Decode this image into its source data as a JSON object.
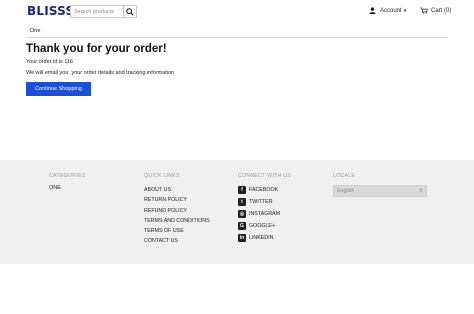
{
  "header": {
    "logo": "BLISSS",
    "logo_dot": ".",
    "search_placeholder": "Search products",
    "account_label": "Account",
    "account_caret": "▾",
    "cart_label": "Cart (0)"
  },
  "breadcrumb": {
    "current": "One"
  },
  "main": {
    "title": "Thank you for your order!",
    "order_line": "Your order id is 116",
    "email_line": "We will email you, your order details and tracking information",
    "continue_label": "Continue Shopping"
  },
  "footer": {
    "categories": {
      "heading": "CATEGORIES",
      "items": [
        "ONE"
      ]
    },
    "quick_links": {
      "heading": "QUICK LINKS",
      "items": [
        "ABOUT US",
        "RETURN POLICY",
        "REFUND POLICY",
        "TERMS AND CONDITIONS",
        "TERMS OF USE",
        "CONTACT US"
      ]
    },
    "connect": {
      "heading": "CONNECT WITH US",
      "items": [
        {
          "label": "FACEBOOK",
          "icon": "facebook-icon",
          "glyph": "f"
        },
        {
          "label": "TWITTER",
          "icon": "twitter-icon",
          "glyph": "t"
        },
        {
          "label": "INSTAGRAM",
          "icon": "instagram-icon",
          "glyph": "◎"
        },
        {
          "label": "GOOGLE+",
          "icon": "google-plus-icon",
          "glyph": "G"
        },
        {
          "label": "LINKEDIN",
          "icon": "linkedin-icon",
          "glyph": "in"
        }
      ]
    },
    "locale": {
      "heading": "LOCALE",
      "selected": "English",
      "arrow": "⇕"
    }
  },
  "colors": {
    "accent": "#1a4fd6",
    "footer_bg": "#f0f0f0",
    "logo": "#1a2b6b"
  }
}
